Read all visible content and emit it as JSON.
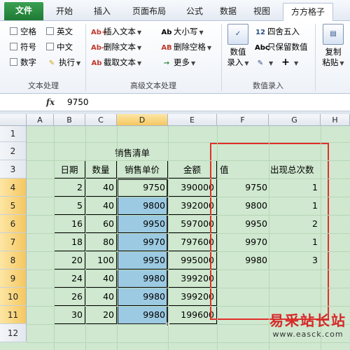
{
  "ribbon": {
    "tabs": [
      "文件",
      "开始",
      "插入",
      "页面布局",
      "公式",
      "数据",
      "视图",
      "方方格子"
    ],
    "active_tab": "方方格子",
    "text_group": {
      "label": "文本处理",
      "checkboxes": [
        "空格",
        "英文",
        "符号",
        "中文",
        "数字"
      ],
      "execute": "执行"
    },
    "advanced_group": {
      "label": "高级文本处理",
      "insert_text": "插入文本",
      "case": "大小写",
      "delete_text": "删除文本",
      "delete_space": "删除空格",
      "extract_text": "截取文本",
      "more": "更多"
    },
    "numeric_group": {
      "label": "数值录入",
      "numeric_entry_line1": "数值",
      "numeric_entry_line2": "录入",
      "round": "四舍五入",
      "keep_value": "只保留数值",
      "copy_line1": "复制",
      "copy_line2": "粘贴"
    },
    "icons": {
      "insert_text": "Ab+",
      "case": "Ab",
      "delete_text": "Ab-",
      "delete_space": "AB",
      "extract_text": "Ab",
      "more": "→",
      "round": "12",
      "keep_value": "Abc",
      "execute": "✎",
      "plus": "+",
      "edit": "✎"
    }
  },
  "formula_bar": {
    "fx": "fx",
    "value": "9750"
  },
  "columns": [
    "A",
    "B",
    "C",
    "D",
    "E",
    "F",
    "G",
    "H"
  ],
  "rows": [
    "1",
    "2",
    "3",
    "4",
    "5",
    "6",
    "7",
    "8",
    "9",
    "10",
    "11",
    "12"
  ],
  "sheet": {
    "title": "销售清单",
    "headers": [
      "日期",
      "数量",
      "销售单价",
      "金额"
    ],
    "table_rows": [
      [
        "2",
        "40",
        "9750",
        "390000"
      ],
      [
        "5",
        "40",
        "9800",
        "392000"
      ],
      [
        "16",
        "60",
        "9950",
        "597000"
      ],
      [
        "18",
        "80",
        "9970",
        "797600"
      ],
      [
        "20",
        "100",
        "9950",
        "995000"
      ],
      [
        "24",
        "40",
        "9980",
        "399200"
      ],
      [
        "26",
        "40",
        "9980",
        "399200"
      ],
      [
        "30",
        "20",
        "9980",
        "199600"
      ]
    ],
    "result_headers": [
      "值",
      "出现总次数"
    ],
    "results": [
      [
        "9750",
        "1"
      ],
      [
        "9800",
        "1"
      ],
      [
        "9950",
        "2"
      ],
      [
        "9970",
        "1"
      ],
      [
        "9980",
        "3"
      ]
    ]
  },
  "watermark": {
    "text": "易采站长站",
    "url": "www.easck.com"
  },
  "colors": {
    "highlight": "#9ccae2",
    "sheet_bg": "#cfe8cf",
    "red_frame": "#e0302a",
    "file_tab": "#2a8a40"
  }
}
